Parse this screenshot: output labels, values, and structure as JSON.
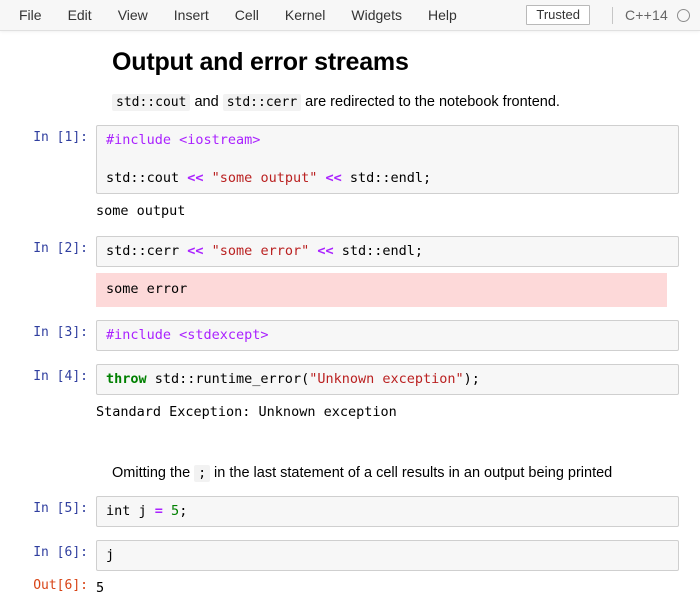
{
  "menubar": {
    "items": [
      "File",
      "Edit",
      "View",
      "Insert",
      "Cell",
      "Kernel",
      "Widgets",
      "Help"
    ],
    "trusted_label": "Trusted",
    "kernel_name": "C++14",
    "kernel_status_icon": "kernel-idle-circle-icon"
  },
  "notebook": {
    "title": "Output and error streams",
    "intro": {
      "code1": "std::cout",
      "text_mid": " and ",
      "code2": "std::cerr",
      "text_end": " are redirected to the notebook frontend."
    },
    "cells": [
      {
        "prompt": "In [1]:",
        "code_line1_a": "#include",
        "code_line1_b": " <iostream>",
        "code_line2_a": "std::cout ",
        "code_line2_op1": "<<",
        "code_line2_str": " \"some output\" ",
        "code_line2_op2": "<<",
        "code_line2_end": " std::endl;",
        "output": "some output",
        "output_type": "stdout"
      },
      {
        "prompt": "In [2]:",
        "code_a": "std::cerr ",
        "code_op1": "<<",
        "code_str": " \"some error\" ",
        "code_op2": "<<",
        "code_end": " std::endl;",
        "output": "some error",
        "output_type": "stderr"
      },
      {
        "prompt": "In [3]:",
        "code_a": "#include",
        "code_b": " <stdexcept>",
        "output": "",
        "output_type": "none"
      },
      {
        "prompt": "In [4]:",
        "code_kw": "throw",
        "code_mid": " std::runtime_error(",
        "code_str": "\"Unknown exception\"",
        "code_end": ");",
        "output": "Standard Exception: Unknown exception",
        "output_type": "stdout"
      }
    ],
    "middle_para": {
      "text_start": "Omitting the ",
      "code": ";",
      "text_end": " in the last statement of a cell results in an output being printed"
    },
    "tail_cells": [
      {
        "prompt": "In [5]:",
        "code_a": "int j ",
        "code_op": "=",
        "code_num": " 5",
        "code_end": ";"
      },
      {
        "prompt": "In [6]:",
        "code_a": "j",
        "out_prompt": "Out[6]:",
        "out_value": "5"
      }
    ]
  },
  "colors": {
    "prompt_in": "#303f9f",
    "prompt_out": "#d84315",
    "stderr_bg": "#fdd9d9",
    "cell_bg": "#f7f7f7",
    "cell_border": "#cfcfcf",
    "string": "#ba2121",
    "keyword": "#008000",
    "operator": "#aa22ff",
    "preprocessor": "#aa22ff"
  }
}
